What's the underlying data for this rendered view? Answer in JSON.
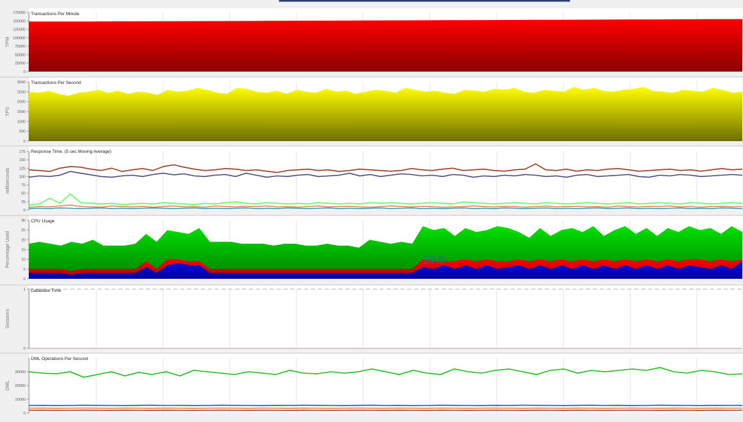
{
  "colors": {
    "tpm": "#e00000",
    "tps": "#ffff00",
    "cpu_user": "#00d000",
    "cpu_system": "#e00000",
    "cpu_iowait": "#0000c0",
    "resp_brown": "#a0402a",
    "resp_navy": "#505080",
    "resp_lime": "#60ff60",
    "dml_green": "#20c020",
    "dml_blue": "#2060c0",
    "dml_brown": "#a05030"
  },
  "cpu_overlay": "19.0",
  "chart_data": [
    {
      "type": "area",
      "title": "Transactions Per Minute",
      "ylabel": "TPM",
      "yticks": [
        "175000",
        "150000",
        "125000",
        "100000",
        "75000",
        "50000",
        "25000",
        "0"
      ],
      "ylim": [
        0,
        175000
      ],
      "series": [
        {
          "values": [
            148000,
            148000,
            148200,
            148500,
            148800,
            149000,
            149300,
            149600,
            150000,
            150300,
            150600,
            151000,
            151300,
            151600,
            152000,
            152300,
            152600,
            153000,
            153300,
            153600,
            154000,
            154300,
            154700,
            155000,
            155300
          ]
        }
      ]
    },
    {
      "type": "area",
      "title": "Transactions Per Second",
      "ylabel": "TPS",
      "yticks": [
        "3000",
        "2500",
        "2000",
        "1500",
        "1000",
        "500",
        "0"
      ],
      "ylim": [
        0,
        3000
      ],
      "series": [
        {
          "values": [
            2500,
            2450,
            2550,
            2400,
            2300,
            2450,
            2500,
            2600,
            2450,
            2550,
            2400,
            2500,
            2450,
            2350,
            2600,
            2500,
            2550,
            2700,
            2600,
            2450,
            2400,
            2700,
            2650,
            2500,
            2450,
            2550,
            2400,
            2600,
            2500,
            2450,
            2650,
            2500,
            2550,
            2400,
            2500,
            2600,
            2550,
            2450,
            2700,
            2600,
            2500,
            2550,
            2450,
            2400,
            2600,
            2550,
            2500,
            2650,
            2600,
            2700,
            2500,
            2450,
            2600,
            2550,
            2500,
            2750,
            2600,
            2700,
            2550,
            2500,
            2600,
            2650,
            2750,
            2550,
            2500,
            2450,
            2600,
            2550,
            2500,
            2700,
            2600,
            2450,
            2500
          ]
        }
      ]
    },
    {
      "type": "line",
      "title": "Response Time. (5 sec Moving Average)",
      "ylabel": "milliseconds",
      "yticks": [
        "175",
        "150",
        "125",
        "100",
        "75",
        "50",
        "25",
        "0"
      ],
      "ylim": [
        0,
        175
      ],
      "series": [
        {
          "values": [
            120,
            118,
            115,
            125,
            130,
            128,
            122,
            118,
            125,
            115,
            120,
            124,
            118,
            130,
            135,
            128,
            122,
            118,
            120,
            124,
            122,
            118,
            120,
            116,
            112,
            118,
            120,
            122,
            118,
            120,
            115,
            118,
            122,
            120,
            118,
            116,
            118,
            124,
            120,
            118,
            122,
            125,
            118,
            120,
            122,
            118,
            116,
            120,
            122,
            138,
            120,
            118,
            122,
            116,
            120,
            118,
            122,
            124,
            120,
            116,
            118,
            120,
            122,
            118,
            120,
            116,
            120,
            124,
            120,
            122
          ]
        },
        {
          "values": [
            98,
            102,
            100,
            104,
            115,
            110,
            105,
            100,
            98,
            102,
            104,
            100,
            106,
            110,
            105,
            108,
            102,
            100,
            104,
            106,
            100,
            110,
            104,
            98,
            102,
            100,
            104,
            106,
            100,
            102,
            104,
            110,
            102,
            106,
            100,
            104,
            108,
            106,
            102,
            104,
            100,
            106,
            104,
            98,
            102,
            100,
            104,
            102,
            106,
            104,
            100,
            102,
            98,
            104,
            106,
            100,
            102,
            104,
            106,
            100,
            98,
            104,
            102,
            106,
            104,
            100,
            102,
            104,
            106,
            104
          ]
        },
        {
          "values": [
            15,
            18,
            35,
            20,
            48,
            22,
            20,
            18,
            20,
            16,
            18,
            20,
            18,
            22,
            20,
            18,
            16,
            20,
            18,
            22,
            24,
            20,
            18,
            22,
            20,
            18,
            20,
            18,
            22,
            20,
            18,
            20,
            18,
            22,
            20,
            22,
            20,
            18,
            20,
            22,
            20,
            18,
            24,
            22,
            20,
            18,
            20,
            22,
            20,
            18,
            22,
            20,
            18,
            20,
            22,
            20,
            18,
            20,
            22,
            18,
            20,
            22,
            20,
            18,
            22,
            20,
            18,
            20,
            22,
            20
          ]
        },
        {
          "values": [
            8,
            10,
            9,
            12,
            15,
            10,
            9,
            8,
            12,
            10,
            9,
            11,
            8,
            10,
            12,
            9,
            10,
            8,
            12,
            10,
            9,
            11,
            10,
            12,
            9,
            10,
            8,
            10,
            12,
            9,
            10,
            11,
            9,
            8,
            10,
            12,
            10,
            9,
            11,
            10,
            8,
            9,
            10,
            12,
            10,
            9,
            11,
            10,
            8,
            10,
            12,
            9,
            10,
            11,
            9,
            10,
            8,
            12,
            10,
            9,
            11,
            10,
            12,
            9,
            10,
            8,
            10,
            11,
            9,
            10
          ]
        },
        {
          "values": [
            4,
            5,
            4,
            6,
            5,
            4,
            5,
            6,
            4,
            5,
            4,
            5,
            6,
            5,
            4,
            5,
            6,
            4,
            5,
            4,
            5,
            6,
            4,
            5,
            4,
            6,
            5,
            4,
            5,
            6,
            4,
            5,
            4,
            5,
            6,
            4,
            5,
            6,
            4,
            5,
            4,
            5,
            6,
            4,
            5,
            4,
            6,
            5,
            4,
            5,
            6,
            4,
            5,
            4,
            5,
            6,
            4,
            5,
            6,
            4,
            5,
            4,
            5,
            6,
            4,
            5,
            4,
            6,
            5,
            4
          ]
        }
      ]
    },
    {
      "type": "area",
      "title": "CPU Usage",
      "ylabel": "Percentage Used",
      "yticks": [
        "30",
        "25",
        "20",
        "15",
        "10",
        "5",
        "0"
      ],
      "ylim": [
        0,
        30
      ],
      "series": [
        {
          "values": [
            18,
            19,
            18,
            17,
            19,
            18,
            20,
            17,
            17,
            17,
            18,
            23,
            19,
            25,
            24,
            23,
            26,
            19,
            19,
            19,
            18,
            18,
            18,
            17,
            18,
            18,
            17,
            17,
            18,
            17,
            17,
            16,
            20,
            19,
            18,
            19,
            18,
            27,
            25,
            26,
            22,
            26,
            24,
            25,
            27,
            26,
            24,
            21,
            26,
            22,
            25,
            26,
            24,
            27,
            22,
            25,
            27,
            23,
            26,
            22,
            26,
            24,
            27,
            25,
            26,
            23,
            27,
            24
          ]
        },
        {
          "values": [
            5,
            5,
            5,
            5,
            4,
            5,
            5,
            5,
            5,
            5,
            5,
            9,
            5,
            10,
            10,
            9,
            9,
            5,
            5,
            5,
            5,
            5,
            5,
            5,
            5,
            5,
            5,
            5,
            5,
            5,
            5,
            5,
            5,
            5,
            5,
            5,
            5,
            10,
            9,
            9,
            9,
            10,
            9,
            10,
            9,
            9,
            10,
            9,
            10,
            9,
            10,
            9,
            10,
            9,
            10,
            9,
            10,
            9,
            10,
            9,
            10,
            9,
            10,
            10,
            9,
            10,
            9,
            10
          ]
        },
        {
          "values": [
            3,
            3,
            3,
            3,
            2,
            3,
            3,
            3,
            3,
            3,
            3,
            6,
            3,
            7,
            8,
            7,
            7,
            3,
            3,
            3,
            3,
            3,
            3,
            3,
            3,
            3,
            3,
            3,
            3,
            3,
            3,
            3,
            3,
            3,
            3,
            3,
            3,
            6,
            5,
            7,
            5,
            7,
            5,
            7,
            5,
            6,
            7,
            5,
            7,
            5,
            7,
            5,
            7,
            5,
            7,
            5,
            7,
            5,
            7,
            5,
            7,
            5,
            7,
            6,
            5,
            7,
            5,
            9
          ]
        }
      ]
    },
    {
      "type": "line",
      "title": "Database Time",
      "ylabel": "Sessions",
      "yticks": [
        "1",
        "0"
      ],
      "ylim": [
        0,
        1
      ],
      "series": [
        {
          "values": [
            0,
            0
          ]
        }
      ]
    },
    {
      "type": "line",
      "title": "DML Operations Per Second",
      "ylabel": "DML",
      "yticks": [
        "30000",
        "20000",
        "10000",
        "0"
      ],
      "ylim": [
        0,
        40000
      ],
      "series": [
        {
          "values": [
            30000,
            29000,
            28500,
            30000,
            26000,
            28000,
            30000,
            27000,
            29500,
            28000,
            30000,
            27000,
            31000,
            30000,
            29000,
            28000,
            30000,
            29000,
            28000,
            31000,
            29000,
            28500,
            30000,
            29000,
            30000,
            32000,
            30000,
            28000,
            31000,
            29000,
            28000,
            32000,
            30000,
            29000,
            31000,
            32000,
            30000,
            28000,
            31000,
            32000,
            29000,
            31000,
            30000,
            31000,
            32000,
            31000,
            33000,
            30000,
            29000,
            31000,
            30000,
            28000,
            28500
          ]
        },
        {
          "values": [
            5500,
            5600,
            5400,
            5500,
            5700,
            5600,
            5500,
            5400,
            5600,
            5700,
            5500,
            5600,
            5400,
            5500,
            5700,
            5600,
            5500,
            5400,
            5600,
            5500,
            5700,
            5600,
            5500,
            5400,
            5600,
            5700,
            5500,
            5600,
            5400,
            5500,
            5700,
            5600,
            5500,
            5400,
            5600,
            5500,
            5700,
            5600,
            5500,
            5400,
            5600,
            5700,
            5500,
            5600,
            5400,
            5500,
            5700,
            5600,
            5500,
            5400,
            5600,
            5500,
            5600
          ]
        },
        {
          "values": [
            3500,
            3600,
            3400,
            3500,
            3600,
            3500,
            3400,
            3600,
            3500,
            3400,
            3600,
            3500,
            3400,
            3500,
            3600,
            3500,
            3400,
            3600,
            3500,
            3400,
            3600,
            3500,
            3400,
            3500,
            3600,
            3500,
            3400,
            3600,
            3500,
            3400,
            3600,
            3500,
            3400,
            3500,
            3600,
            3500,
            3400,
            3600,
            3500,
            3400,
            3600,
            3500,
            3400,
            3500,
            3600,
            3500,
            3400,
            3600,
            3500,
            3400,
            3600,
            3500,
            3500
          ]
        },
        {
          "values": [
            2000,
            2100,
            1900,
            2000,
            2100,
            2000,
            1900,
            2100,
            2000,
            1900,
            2100,
            2000,
            1900,
            2000,
            2100,
            2000,
            1900,
            2100,
            2000,
            1900,
            2100,
            2000,
            1900,
            2000,
            2100,
            2000,
            1900,
            2100,
            2000,
            1900,
            2100,
            2000,
            1900,
            2000,
            2100,
            2000,
            1900,
            2100,
            2000,
            1900,
            2100,
            2000,
            1900,
            2000,
            2100,
            2000,
            1900,
            2100,
            2000,
            1900,
            2100,
            2000,
            2000
          ]
        }
      ]
    }
  ]
}
